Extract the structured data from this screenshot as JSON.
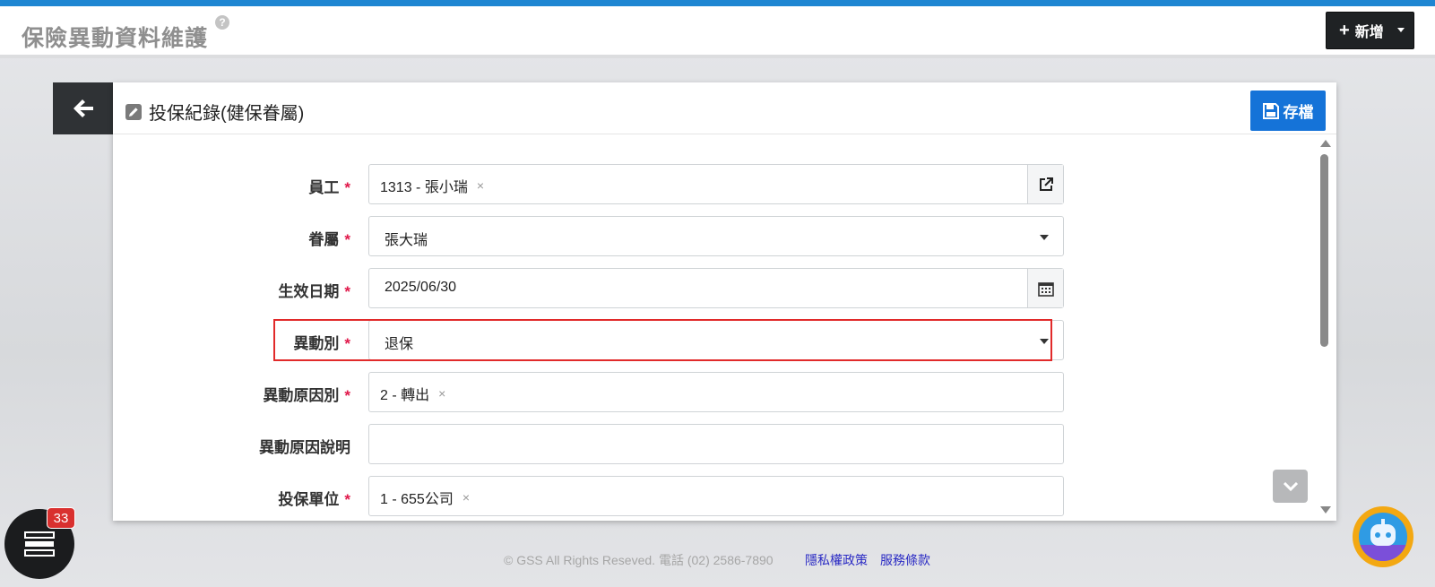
{
  "header": {
    "title": "保險異動資料維護",
    "help": "?",
    "add_button": "新增",
    "add_plus": "+"
  },
  "card": {
    "title": "投保紀錄(健保眷屬)",
    "save_label": "存檔"
  },
  "form": {
    "employee": {
      "label": "員工",
      "value": "1313 - 張小瑞",
      "clear": "×"
    },
    "dependent": {
      "label": "眷屬",
      "value": "張大瑞"
    },
    "effective_date": {
      "label": "生效日期",
      "value": "2025/06/30"
    },
    "change_type": {
      "label": "異動別",
      "value": "退保"
    },
    "change_reason": {
      "label": "異動原因別",
      "value": "2 - 轉出",
      "clear": "×"
    },
    "reason_desc": {
      "label": "異動原因說明",
      "value": ""
    },
    "insured_unit": {
      "label": "投保單位",
      "value": "1 - 655公司",
      "clear": "×"
    },
    "required_mark": "*"
  },
  "footer": {
    "copyright": "© GSS All Rights Reseved. 電話 (02) 2586-7890",
    "privacy": "隱私權政策",
    "terms": "服務條款"
  },
  "fab": {
    "badge_count": "33"
  },
  "colors": {
    "accent": "#1573d8",
    "topbar": "#1f86d2",
    "highlight": "#e12a2a",
    "required": "#e0184a"
  }
}
